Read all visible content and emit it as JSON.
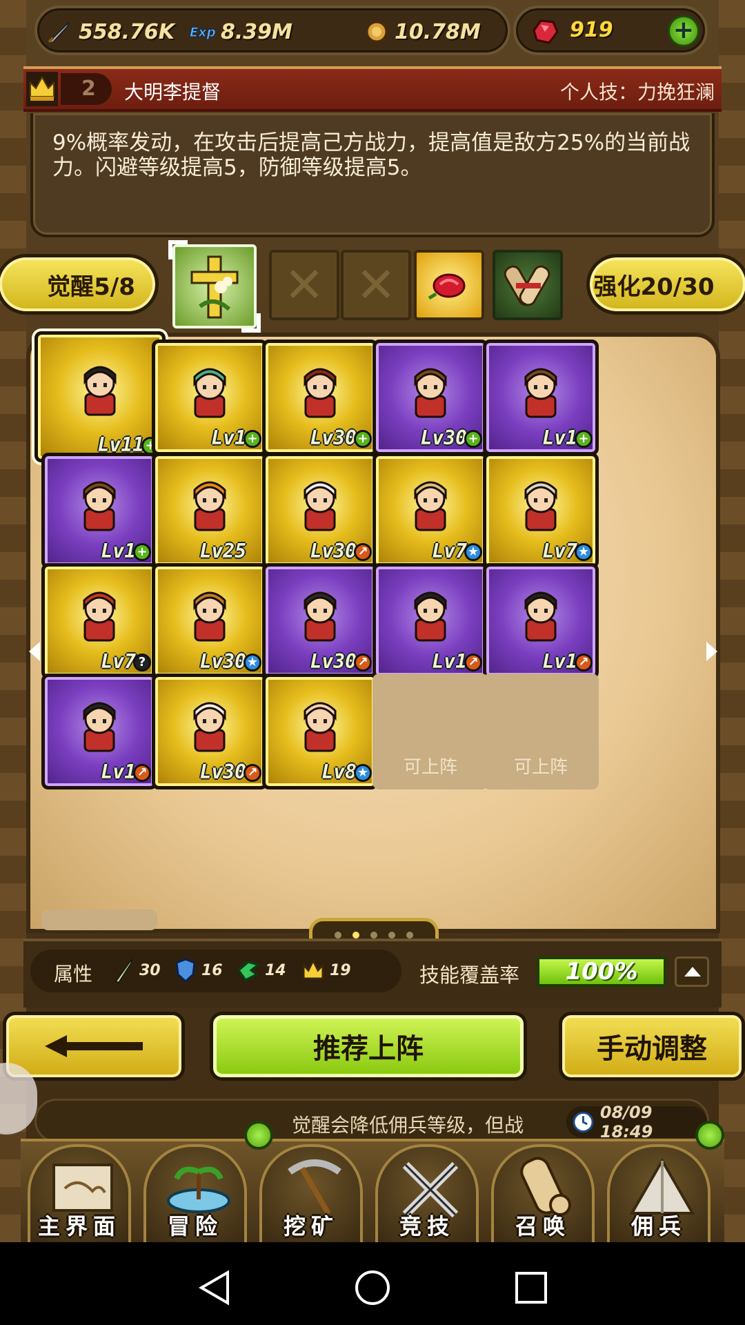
{
  "resources": {
    "attack": "558.76K",
    "exp": "8.39M",
    "gold": "10.78M",
    "gems": "919"
  },
  "skill": {
    "rank": "2",
    "hero_name": "大明李提督",
    "skill_title": "个人技：力挽狂澜",
    "description": "9%概率发动，在攻击后提高己方战力，提高值是敌方25%的当前战力。闪避等级提高5，防御等级提高5。"
  },
  "awaken": {
    "label": "觉醒5/8",
    "enhance_label": "强化20/30",
    "empty_mark": "✕"
  },
  "roster": [
    {
      "level": "Lv11",
      "frame": "gold",
      "badge": "plus",
      "selected": true
    },
    {
      "level": "Lv1",
      "frame": "gold",
      "badge": "plus"
    },
    {
      "level": "Lv30",
      "frame": "gold",
      "badge": "plus"
    },
    {
      "level": "Lv30",
      "frame": "purple",
      "badge": "plus"
    },
    {
      "level": "Lv1",
      "frame": "purple",
      "badge": "plus"
    },
    {
      "level": "Lv1",
      "frame": "purple",
      "badge": "plus"
    },
    {
      "level": "Lv25",
      "frame": "gold",
      "badge": "none"
    },
    {
      "level": "Lv30",
      "frame": "gold",
      "badge": "up"
    },
    {
      "level": "Lv7",
      "frame": "gold",
      "badge": "star"
    },
    {
      "level": "Lv7",
      "frame": "gold",
      "badge": "star"
    },
    {
      "level": "Lv7",
      "frame": "gold",
      "badge": "question"
    },
    {
      "level": "Lv30",
      "frame": "gold",
      "badge": "star"
    },
    {
      "level": "Lv30",
      "frame": "purple",
      "badge": "up"
    },
    {
      "level": "Lv1",
      "frame": "purple",
      "badge": "up"
    },
    {
      "level": "Lv1",
      "frame": "purple",
      "badge": "up"
    },
    {
      "level": "Lv1",
      "frame": "purple",
      "badge": "up"
    },
    {
      "level": "Lv30",
      "frame": "gold",
      "badge": "up"
    },
    {
      "level": "Lv8",
      "frame": "gold",
      "badge": "star"
    }
  ],
  "open_slot_label": "可上阵",
  "pager": {
    "pages": 5,
    "current": 2
  },
  "stats": {
    "label": "属性",
    "attack": "30",
    "defense": "16",
    "agility": "14",
    "crown": "19",
    "coverage_label": "技能覆盖率",
    "coverage_value": "100%"
  },
  "buttons": {
    "recommend": "推荐上阵",
    "manual": "手动调整"
  },
  "ticker": {
    "text": "觉醒会降低佣兵等级，但战",
    "time": "08/09 18:49"
  },
  "nav": [
    {
      "label": "主界面",
      "icon": "scroll-map-icon"
    },
    {
      "label": "冒险",
      "icon": "island-icon"
    },
    {
      "label": "挖矿",
      "icon": "pickaxe-icon"
    },
    {
      "label": "竞技",
      "icon": "crossed-swords-icon"
    },
    {
      "label": "召唤",
      "icon": "summon-scroll-icon"
    },
    {
      "label": "佣兵",
      "icon": "tent-icon"
    }
  ],
  "colors": {
    "gold_frame": "#e6bd1d",
    "purple_frame": "#7a3ebf",
    "accent_green": "#86c70c"
  }
}
